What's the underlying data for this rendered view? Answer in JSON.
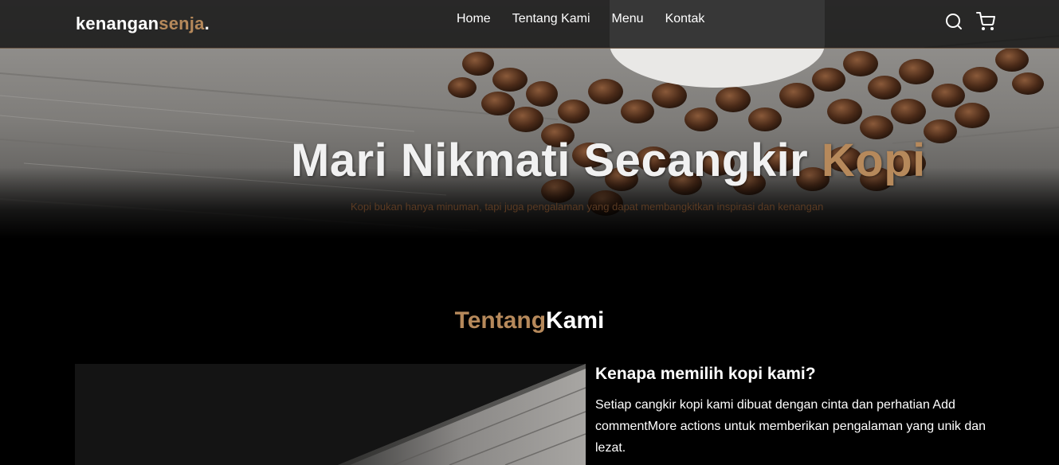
{
  "brand": {
    "logo_part1": "kenangan",
    "logo_part2": "senja",
    "logo_dot": "."
  },
  "nav": {
    "links": [
      "Home",
      "Tentang Kami",
      "Menu",
      "Kontak"
    ],
    "icons": [
      "search-icon",
      "shopping-cart-icon"
    ]
  },
  "hero": {
    "title_part1": "Mari Nikmati Secangkir ",
    "title_part2": "Kopi",
    "subtitle": "Kopi bukan hanya minuman, tapi juga pengalaman yang dapat membangkitkan inspirasi dan kenangan"
  },
  "about": {
    "title_part1": "Tentang",
    "title_part2": "Kami",
    "heading": "Kenapa memilih kopi kami?",
    "paragraph": "Setiap cangkir kopi kami dibuat dengan cinta dan perhatian Add commentMore actions untuk memberikan pengalaman yang unik dan lezat."
  },
  "colors": {
    "accent": "#b6895b",
    "navbar_bg": "#101010",
    "page_bg": "#000000"
  }
}
